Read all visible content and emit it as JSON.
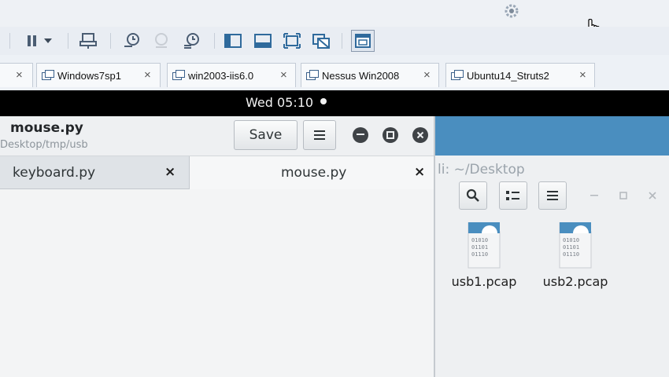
{
  "vmware": {
    "toolbar_icons": [
      "pause-icon",
      "dropdown-arrow-icon",
      "send-keys-icon",
      "snapshot-take-icon",
      "snapshot-revert-icon",
      "snapshot-manager-icon",
      "console-view-icon",
      "fullscreen-bar-icon",
      "fullscreen-icon",
      "unity-icon",
      "thumbnail-view-icon"
    ],
    "tabs": [
      {
        "label": "",
        "close": "×"
      },
      {
        "label": "Windows7sp1",
        "close": "×"
      },
      {
        "label": "win2003-iis6.0",
        "close": "×"
      },
      {
        "label": "Nessus Win2008",
        "close": "×"
      },
      {
        "label": "Ubuntu14_Struts2",
        "close": "×"
      }
    ]
  },
  "kali_topbar": {
    "clock": "Wed 05:10"
  },
  "gedit": {
    "title": "mouse.py",
    "subtitle": "Desktop/tmp/usb",
    "save_label": "Save",
    "menu_icon": "hamburger-icon",
    "tabs": [
      {
        "label": "keyboard.py",
        "close": "×",
        "active": false
      },
      {
        "label": "mouse.py",
        "close": "×",
        "active": true
      }
    ]
  },
  "nautilus": {
    "title": "li: ~/Desktop",
    "toolbar_icons": [
      "search-icon",
      "grid-view-icon",
      "hamburger-icon"
    ],
    "files": [
      {
        "name": "usb1.pcap",
        "icon": "binary-file-icon",
        "glyph": "01010\n01101\n01110"
      },
      {
        "name": "usb2.pcap",
        "icon": "binary-file-icon",
        "glyph": "01010\n01101\n01110"
      }
    ]
  },
  "colors": {
    "kali_header_blue": "#4a8ebf",
    "topbar_black": "#000000",
    "window_bg": "#eef0f2"
  }
}
